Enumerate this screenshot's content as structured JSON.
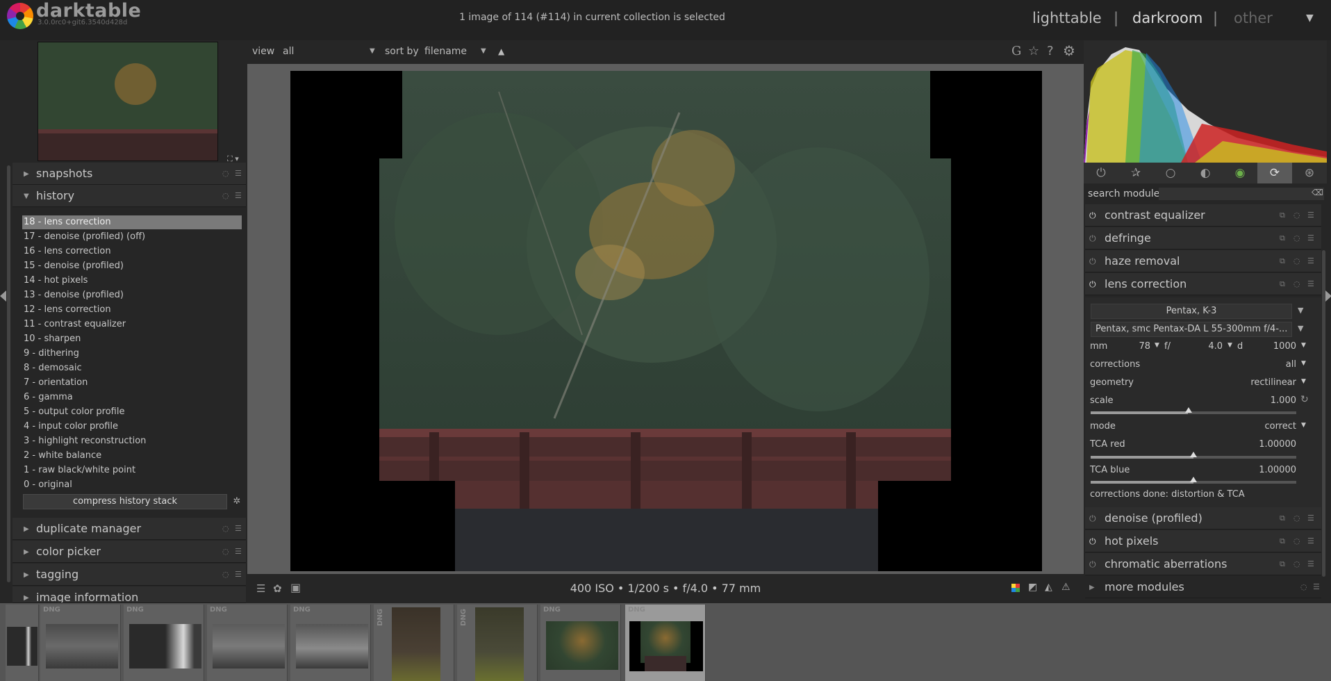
{
  "app": {
    "name": "darktable",
    "version": "3.0.0rc0+git6.3540d428d"
  },
  "header": {
    "collection_status": "1 image of 114 (#114) in current collection is selected",
    "views": [
      "lighttable",
      "darkroom",
      "other"
    ],
    "separator": "|",
    "dropdown_glyph": "▼"
  },
  "left": {
    "modules": {
      "snapshots": "snapshots",
      "history": "history",
      "duplicate_manager": "duplicate manager",
      "color_picker": "color picker",
      "tagging": "tagging",
      "image_information": "image information"
    },
    "history_items": [
      "18 - lens correction",
      "17 - denoise (profiled) (off)",
      "16 - lens correction",
      "15 - denoise (profiled)",
      "14 - hot pixels",
      "13 - denoise (profiled)",
      "12 - lens correction",
      "11 - contrast equalizer",
      "10 - sharpen",
      "9 - dithering",
      "8 - demosaic",
      "7 - orientation",
      "6 - gamma",
      "5 - output color profile",
      "4 - input color profile",
      "3 - highlight reconstruction",
      "2 - white balance",
      "1 - raw black/white point",
      "0 - original"
    ],
    "compress_label": "compress history stack"
  },
  "toolbar": {
    "view_label": "view",
    "view_value": "all",
    "sort_label": "sort by",
    "sort_value": "filename",
    "sort_dir": "▲",
    "icons": [
      "G",
      "☆",
      "?",
      "⚙"
    ]
  },
  "bottom": {
    "exif": "400 ISO • 1/200 s • f/4.0 • 77 mm"
  },
  "right": {
    "search_label": "search module",
    "modules_top": [
      "contrast equalizer",
      "defringe",
      "haze removal",
      "lens correction"
    ],
    "modules_bottom": [
      "denoise (profiled)",
      "hot pixels",
      "chromatic aberrations"
    ],
    "more_modules": "more modules",
    "lens": {
      "camera": "Pentax, K-3",
      "lens": "Pentax, smc Pentax-DA L 55-300mm f/4-...",
      "mm_label": "mm",
      "mm_value": "78",
      "f_label": "f/",
      "f_value": "4.0",
      "d_label": "d",
      "d_value": "1000",
      "corrections_label": "corrections",
      "corrections_value": "all",
      "geometry_label": "geometry",
      "geometry_value": "rectilinear",
      "scale_label": "scale",
      "scale_value": "1.000",
      "mode_label": "mode",
      "mode_value": "correct",
      "tca_red_label": "TCA red",
      "tca_red_value": "1.00000",
      "tca_blue_label": "TCA blue",
      "tca_blue_value": "1.00000",
      "status": "corrections done: distortion & TCA"
    }
  },
  "filmstrip": {
    "tag": "DNG"
  }
}
